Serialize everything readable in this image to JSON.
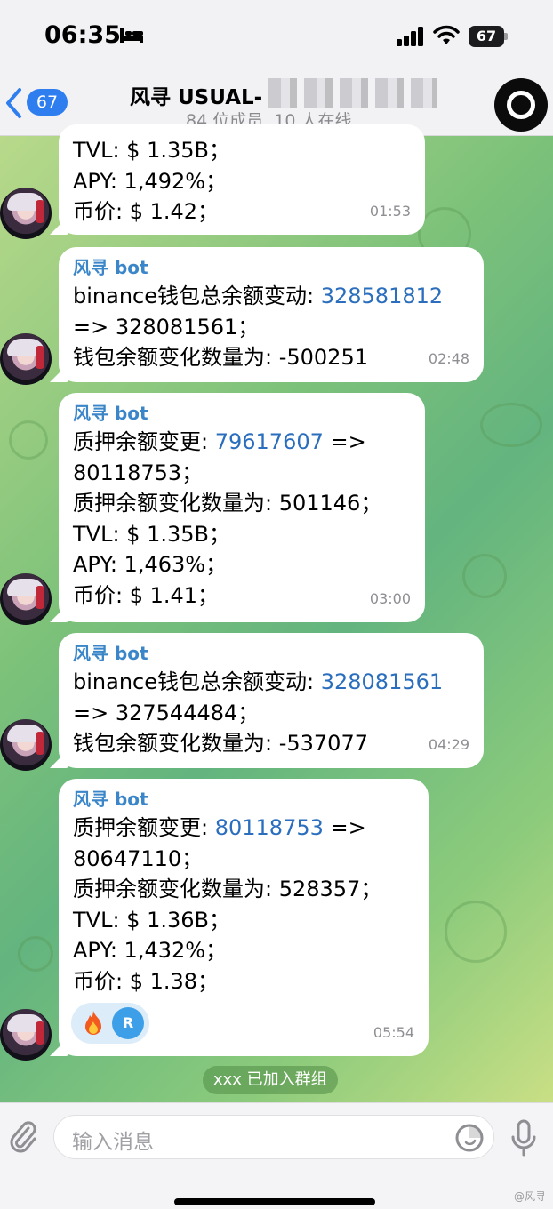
{
  "status": {
    "time": "06:35",
    "battery": "67"
  },
  "header": {
    "back_count": "67",
    "title": "风寻 USUAL-",
    "subtitle": "84 位成员, 10 人在线"
  },
  "messages": [
    {
      "sender": "",
      "lines": [
        "TVL: $ 1.35B；",
        "APY: 1,492%；",
        "币价: $ 1.42；"
      ],
      "time": "01:53"
    },
    {
      "sender": "风寻 bot",
      "lines": [
        "binance钱包总余额变动: ",
        "=> 328081561；",
        "钱包余额变化数量为: -500251"
      ],
      "link": "328581812",
      "time": "02:48"
    },
    {
      "sender": "风寻 bot",
      "lines": [
        "质押余额变更: ",
        "80118753；",
        "质押余额变化数量为: 501146；",
        "TVL: $ 1.35B；",
        "APY: 1,463%；",
        "币价: $ 1.41；"
      ],
      "link": "79617607",
      "link_suffix": " =>",
      "time": "03:00"
    },
    {
      "sender": "风寻 bot",
      "lines": [
        "binance钱包总余额变动: ",
        "=> 327544484；",
        "钱包余额变化数量为: -537077"
      ],
      "link": "328081561",
      "time": "04:29"
    },
    {
      "sender": "风寻 bot",
      "lines": [
        "质押余额变更: ",
        "80647110；",
        "质押余额变化数量为: 528357；",
        "TVL: $ 1.36B；",
        "APY: 1,432%；",
        "币价: $ 1.38；"
      ],
      "link": "80118753",
      "link_suffix": " =>",
      "time": "05:54",
      "reaction_avatar": "R"
    }
  ],
  "service_message": "xxx 已加入群组",
  "input": {
    "placeholder": "输入消息"
  },
  "watermark": "@风寻"
}
